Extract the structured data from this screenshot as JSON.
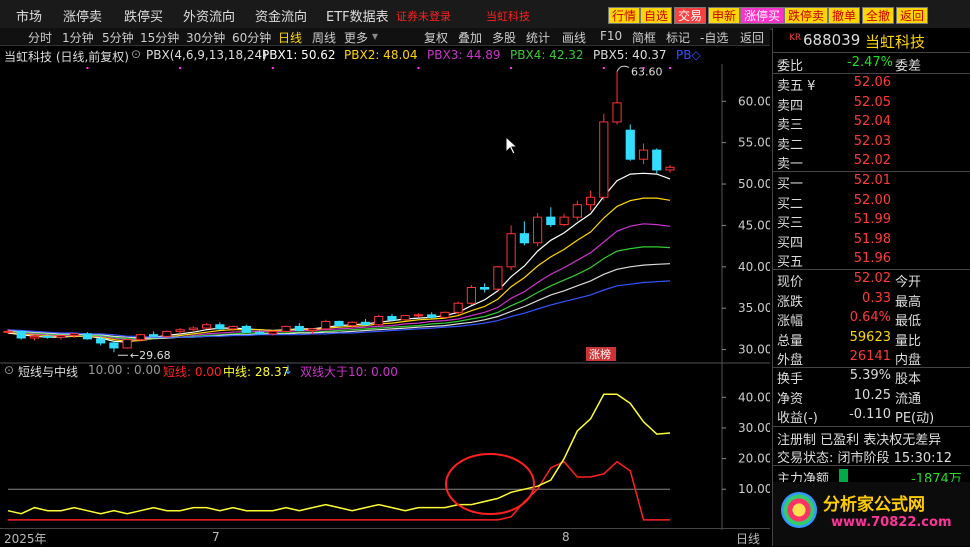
{
  "top_menu": [
    "市场",
    "涨停卖",
    "跌停买",
    "外资流向",
    "资金流向",
    "ETF数据表"
  ],
  "top_notice": "证券未登录",
  "top_stock": "当虹科技",
  "top_buttons": [
    "行情",
    "自选",
    "交易",
    "申新",
    "涨停买",
    "跌停卖",
    "撤单",
    "全撤",
    "返回"
  ],
  "periods": [
    "分时",
    "1分钟",
    "5分钟",
    "15分钟",
    "30分钟",
    "60分钟",
    "日线",
    "周线",
    "更多"
  ],
  "period_active": "日线",
  "tools": [
    "复权",
    "叠加",
    "多股",
    "统计",
    "画线",
    "F10",
    "简框",
    "标记",
    "-自选",
    "返回"
  ],
  "indicator": {
    "stock_label": "当虹科技 (日线,前复权)",
    "params": "PBX(4,6,9,13,18,24)",
    "pbx1": "PBX1: 50.62",
    "pbx2": "PBX2: 48.04",
    "pbx3": "PBX3: 44.89",
    "pbx4": "PBX4: 42.32",
    "pbx5": "PBX5: 40.37",
    "pbx6": "PB◇"
  },
  "sub_indicator": {
    "name": "短线与中线",
    "params": "10.00 : 0.00",
    "short": "短线: 0.00",
    "mid": "中线: 28.37",
    "both": "双线大于10: 0.00"
  },
  "annotations": {
    "high": "63.60",
    "low": "29.68",
    "zhangting": "涨榜"
  },
  "y_main": [
    "60.00",
    "55.00",
    "50.00",
    "45.00",
    "40.00",
    "35.00",
    "30.00"
  ],
  "y_sub": [
    "40.00",
    "30.00",
    "20.00",
    "10.00"
  ],
  "x_labels": [
    "2025年",
    "7",
    "8"
  ],
  "x_right": "日线",
  "right": {
    "code_prefix": "KR",
    "code": "688039",
    "name": "当虹科技",
    "weibi_label": "委比",
    "weibi": "-2.47%",
    "weicha_label": "委差",
    "asks": [
      {
        "label": "卖五 ¥",
        "price": "52.06"
      },
      {
        "label": "卖四",
        "price": "52.05"
      },
      {
        "label": "卖三",
        "price": "52.04"
      },
      {
        "label": "卖二",
        "price": "52.03"
      },
      {
        "label": "卖一",
        "price": "52.02"
      }
    ],
    "bids": [
      {
        "label": "买一",
        "price": "52.01"
      },
      {
        "label": "买二",
        "price": "52.00"
      },
      {
        "label": "买三",
        "price": "51.99"
      },
      {
        "label": "买四",
        "price": "51.98"
      },
      {
        "label": "买五",
        "price": "51.96"
      }
    ],
    "quote": [
      {
        "l1": "现价",
        "v": "52.02",
        "l2": "今开"
      },
      {
        "l1": "涨跌",
        "v": "0.33",
        "l2": "最高"
      },
      {
        "l1": "涨幅",
        "v": "0.64%",
        "l2": "最低"
      },
      {
        "l1": "总量",
        "v": "59623",
        "l2": "量比",
        "vcolor": "#ffd700"
      },
      {
        "l1": "外盘",
        "v": "26141",
        "l2": "内盘"
      }
    ],
    "fin": [
      {
        "l1": "换手",
        "v": "5.39%",
        "l2": "股本"
      },
      {
        "l1": "净资",
        "v": "10.25",
        "l2": "流通"
      },
      {
        "l1": "收益(-)",
        "v": "-0.110",
        "l2": "PE(动)"
      }
    ],
    "reg": "注册制  已盈利  表决权无差异",
    "status": "交易状态: 闭市阶段 15:30:12",
    "flow_label": "主力净额",
    "flow_value": "-1874万"
  },
  "watermark": "分析家公式网",
  "watermark_url": "www.70822.com",
  "chart_data": {
    "type": "candlestick",
    "ohlc": [
      [
        32.1,
        32.5,
        31.9,
        32.2
      ],
      [
        32.2,
        32.3,
        31.2,
        31.4
      ],
      [
        31.4,
        31.8,
        31.1,
        31.6
      ],
      [
        31.6,
        31.9,
        31.3,
        31.5
      ],
      [
        31.5,
        31.8,
        31.2,
        31.7
      ],
      [
        31.7,
        32.0,
        31.4,
        31.9
      ],
      [
        31.9,
        32.1,
        31.2,
        31.3
      ],
      [
        31.3,
        31.6,
        30.5,
        30.8
      ],
      [
        30.8,
        31.0,
        29.68,
        30.2
      ],
      [
        30.2,
        31.3,
        30.1,
        31.2
      ],
      [
        31.2,
        31.9,
        31.0,
        31.8
      ],
      [
        31.8,
        32.2,
        31.5,
        31.6
      ],
      [
        31.6,
        32.3,
        31.4,
        32.2
      ],
      [
        32.2,
        32.6,
        31.9,
        32.4
      ],
      [
        32.4,
        32.8,
        32.1,
        32.6
      ],
      [
        32.6,
        33.2,
        32.5,
        33.0
      ],
      [
        33.0,
        33.3,
        32.4,
        32.5
      ],
      [
        32.5,
        32.9,
        32.2,
        32.8
      ],
      [
        32.8,
        33.0,
        32.0,
        32.1
      ],
      [
        32.1,
        32.4,
        31.8,
        31.9
      ],
      [
        31.9,
        32.3,
        31.7,
        32.2
      ],
      [
        32.2,
        32.9,
        32.1,
        32.8
      ],
      [
        32.8,
        33.2,
        32.2,
        32.3
      ],
      [
        32.3,
        32.6,
        31.9,
        32.5
      ],
      [
        32.5,
        33.6,
        32.4,
        33.4
      ],
      [
        33.4,
        33.5,
        32.8,
        32.9
      ],
      [
        32.9,
        33.4,
        32.6,
        33.3
      ],
      [
        33.3,
        33.7,
        32.9,
        33.0
      ],
      [
        33.0,
        34.2,
        32.9,
        34.0
      ],
      [
        34.0,
        34.3,
        33.4,
        33.6
      ],
      [
        33.6,
        34.2,
        33.5,
        34.1
      ],
      [
        34.1,
        34.4,
        33.9,
        34.2
      ],
      [
        34.2,
        34.5,
        33.7,
        33.9
      ],
      [
        33.9,
        34.6,
        33.8,
        34.5
      ],
      [
        34.5,
        35.8,
        34.2,
        35.6
      ],
      [
        35.6,
        37.8,
        35.4,
        37.5
      ],
      [
        37.5,
        38.0,
        36.9,
        37.3
      ],
      [
        37.3,
        40.1,
        37.1,
        40.0
      ],
      [
        40.0,
        45.0,
        39.6,
        44.0
      ],
      [
        44.0,
        45.5,
        42.6,
        42.9
      ],
      [
        42.9,
        46.5,
        42.5,
        46.0
      ],
      [
        46.0,
        47.2,
        44.8,
        45.1
      ],
      [
        45.1,
        46.4,
        44.9,
        46.0
      ],
      [
        46.0,
        48.0,
        45.6,
        47.5
      ],
      [
        47.5,
        49.2,
        46.8,
        48.4
      ],
      [
        48.4,
        58.5,
        48.0,
        57.5
      ],
      [
        57.5,
        63.6,
        57.2,
        59.8
      ],
      [
        56.5,
        57.2,
        52.8,
        53.0
      ],
      [
        53.0,
        54.9,
        52.4,
        54.1
      ],
      [
        54.1,
        54.3,
        51.3,
        51.7
      ],
      [
        51.7,
        52.3,
        51.4,
        52.02
      ]
    ],
    "pbx": [
      {
        "name": "PBX1",
        "color": "#ffffff",
        "values": [
          32.0,
          31.8,
          31.6,
          31.5,
          31.5,
          31.6,
          31.6,
          31.4,
          31.0,
          30.9,
          31.2,
          31.5,
          31.7,
          31.9,
          32.1,
          32.4,
          32.6,
          32.6,
          32.5,
          32.4,
          32.3,
          32.4,
          32.5,
          32.5,
          32.7,
          32.9,
          33.0,
          33.1,
          33.3,
          33.5,
          33.7,
          33.8,
          33.9,
          34.1,
          34.5,
          35.3,
          36.0,
          37.1,
          38.8,
          40.1,
          41.9,
          43.2,
          44.1,
          45.3,
          46.4,
          48.5,
          50.4,
          51.2,
          51.3,
          51.2,
          50.62
        ]
      },
      {
        "name": "PBX2",
        "color": "#ffd700",
        "values": [
          32.1,
          31.9,
          31.8,
          31.7,
          31.6,
          31.6,
          31.6,
          31.5,
          31.2,
          31.0,
          31.1,
          31.3,
          31.5,
          31.7,
          31.9,
          32.1,
          32.3,
          32.4,
          32.4,
          32.4,
          32.3,
          32.3,
          32.4,
          32.4,
          32.6,
          32.7,
          32.8,
          32.9,
          33.1,
          33.2,
          33.4,
          33.6,
          33.7,
          33.8,
          34.1,
          34.7,
          35.2,
          36.1,
          37.6,
          38.7,
          40.1,
          41.2,
          42.1,
          43.2,
          44.2,
          45.9,
          47.3,
          48.0,
          48.3,
          48.3,
          48.04
        ]
      },
      {
        "name": "PBX3",
        "color": "#cc33cc",
        "values": [
          32.2,
          32.0,
          31.9,
          31.8,
          31.7,
          31.7,
          31.7,
          31.6,
          31.4,
          31.2,
          31.2,
          31.3,
          31.4,
          31.5,
          31.7,
          31.9,
          32.0,
          32.1,
          32.2,
          32.2,
          32.2,
          32.2,
          32.3,
          32.3,
          32.4,
          32.5,
          32.6,
          32.7,
          32.8,
          32.9,
          33.1,
          33.2,
          33.4,
          33.5,
          33.7,
          34.1,
          34.5,
          35.1,
          36.2,
          37.0,
          38.1,
          39.1,
          39.9,
          40.8,
          41.7,
          43.0,
          44.3,
          44.9,
          45.2,
          45.1,
          44.89
        ]
      },
      {
        "name": "PBX4",
        "color": "#33cc33",
        "values": [
          32.2,
          32.1,
          32.0,
          31.9,
          31.8,
          31.8,
          31.7,
          31.7,
          31.5,
          31.3,
          31.3,
          31.3,
          31.4,
          31.5,
          31.6,
          31.7,
          31.8,
          31.9,
          32.0,
          32.0,
          32.0,
          32.0,
          32.1,
          32.1,
          32.2,
          32.3,
          32.4,
          32.5,
          32.6,
          32.7,
          32.8,
          32.9,
          33.1,
          33.2,
          33.4,
          33.7,
          34.0,
          34.5,
          35.3,
          36.0,
          36.9,
          37.7,
          38.4,
          39.1,
          39.9,
          41.0,
          41.9,
          42.2,
          42.4,
          42.4,
          42.32
        ]
      },
      {
        "name": "PBX5",
        "color": "#dddddd",
        "values": [
          32.3,
          32.2,
          32.1,
          32.0,
          31.9,
          31.9,
          31.8,
          31.8,
          31.6,
          31.5,
          31.4,
          31.4,
          31.4,
          31.5,
          31.5,
          31.6,
          31.7,
          31.8,
          31.8,
          31.9,
          31.9,
          31.9,
          32.0,
          32.0,
          32.1,
          32.1,
          32.2,
          32.3,
          32.4,
          32.5,
          32.6,
          32.7,
          32.8,
          32.9,
          33.1,
          33.3,
          33.6,
          34.0,
          34.6,
          35.2,
          35.9,
          36.6,
          37.1,
          37.7,
          38.3,
          39.1,
          39.7,
          40.0,
          40.2,
          40.3,
          40.37
        ]
      },
      {
        "name": "PBX6",
        "color": "#3355ff",
        "values": [
          32.4,
          32.3,
          32.2,
          32.1,
          32.0,
          32.0,
          31.9,
          31.9,
          31.8,
          31.6,
          31.6,
          31.5,
          31.5,
          31.5,
          31.5,
          31.6,
          31.6,
          31.7,
          31.7,
          31.8,
          31.8,
          31.8,
          31.8,
          31.9,
          31.9,
          32.0,
          32.0,
          32.1,
          32.2,
          32.3,
          32.4,
          32.5,
          32.6,
          32.7,
          32.8,
          33.0,
          33.2,
          33.5,
          34.0,
          34.4,
          34.9,
          35.4,
          35.8,
          36.2,
          36.6,
          37.2,
          37.7,
          37.9,
          38.1,
          38.2,
          38.3
        ]
      }
    ],
    "sub_series": [
      {
        "name": "短线",
        "color": "#ff2020",
        "values": [
          0,
          0,
          0,
          0,
          0,
          0,
          0,
          0,
          0,
          0,
          0,
          0,
          0,
          0,
          0,
          0,
          0,
          0,
          0,
          0,
          0,
          0,
          0,
          0,
          0,
          0,
          0,
          0,
          0,
          0,
          0,
          0,
          0,
          0,
          0,
          0,
          0,
          0,
          1,
          6,
          10,
          17,
          19,
          14,
          14,
          15,
          19,
          16,
          0,
          0,
          0
        ]
      },
      {
        "name": "中线",
        "color": "#ffff33",
        "values": [
          3,
          2,
          4,
          3,
          3,
          4,
          3,
          2,
          3,
          2,
          3,
          4,
          3,
          3,
          4,
          4,
          3,
          4,
          3,
          3,
          3,
          4,
          3,
          4,
          5,
          4,
          3,
          4,
          5,
          4,
          3,
          4,
          4,
          4,
          5,
          5,
          6,
          7,
          9,
          10,
          11,
          13,
          20,
          29,
          33,
          41,
          41,
          38,
          32,
          28,
          28.37
        ]
      }
    ],
    "y_main_range": [
      28.5,
      64.5
    ],
    "y_sub_range": [
      -2,
      45
    ]
  }
}
